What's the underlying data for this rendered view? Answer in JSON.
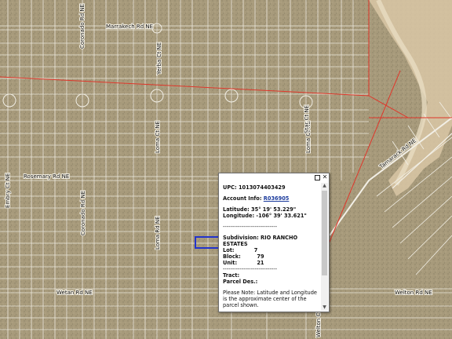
{
  "map": {
    "road_labels": [
      "Marrakech Rd NE",
      "Coronado Rd NE",
      "Yerba Ct NE",
      "Loma Ct NE",
      "Loma Ct NE",
      "Rosemary Rd NE",
      "Embry Ct NE",
      "Coronado Rd NE",
      "Loma Rd NE",
      "Star Ct NE",
      "Tamarack Rd NE",
      "Wetan Rd NE",
      "Welton Rd NE",
      "Welton Ct NE",
      "Lt NE"
    ],
    "colors": {
      "parcel_line": "#f2efe6",
      "boundary": "#e0362a",
      "selected_parcel": "#2233cc",
      "arroyo": "#ddc8a8"
    }
  },
  "popup": {
    "upc": "UPC: 1013074403429",
    "account_label": "Account Info:",
    "account_link": "R036905",
    "latitude": "Latitude: 35° 19' 53.229\"",
    "longitude": "Longitude: -106° 39' 33.621\"",
    "separator": "-----------------------------",
    "subdivision": "Subdivision: RIO RANCHO",
    "subdivision_cont": "ESTATES",
    "lot": "Lot:           7",
    "block": "Block:         79",
    "unit": "Unit:           21",
    "separator2": "-----------------------------",
    "tract": "Tract:",
    "parcel_des": "Parcel Des.:",
    "note": "Please Note: Latitude and Longitude is the approximate center of the parcel shown.",
    "maximize_icon": "maximize-icon",
    "close_icon": "close-icon"
  }
}
